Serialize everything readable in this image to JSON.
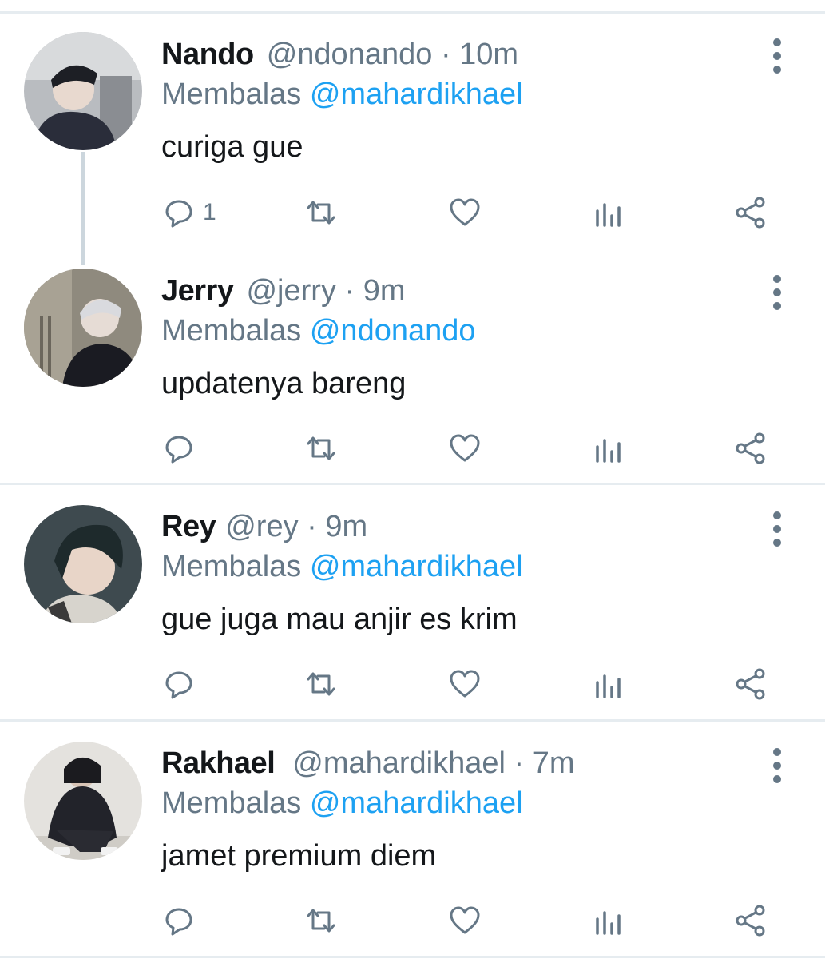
{
  "tweets": [
    {
      "name": "Nando",
      "handle": "@ndonando",
      "time": "· 10m",
      "reply_prefix": "Membalas",
      "reply_to": "@mahardikhael",
      "text": "curiga gue",
      "reply_count": "1",
      "avatar": "avatar-photo"
    },
    {
      "name": "Jerry",
      "handle": "@jerry",
      "time": "· 9m",
      "reply_prefix": "Membalas",
      "reply_to": "@ndonando",
      "text": "updatenya bareng",
      "reply_count": "",
      "avatar": "avatar-photo"
    },
    {
      "name": "Rey",
      "handle": "@rey",
      "time": "· 9m",
      "reply_prefix": "Membalas",
      "reply_to": "@mahardikhael",
      "text": "gue juga mau anjir es krim",
      "reply_count": "",
      "avatar": "avatar-photo"
    },
    {
      "name": "Rakhael",
      "handle": "@mahardikhael",
      "time": "· 7m",
      "reply_prefix": "Membalas",
      "reply_to": "@mahardikhael",
      "text": "jamet premium diem",
      "reply_count": "",
      "avatar": "avatar-photo"
    }
  ],
  "icons": {
    "reply": "reply-icon",
    "retweet": "retweet-icon",
    "like": "heart-icon",
    "analytics": "analytics-icon",
    "share": "share-icon",
    "more": "more-vertical-icon"
  },
  "colors": {
    "name": "#14171a",
    "secondary": "#657786",
    "mention": "#1da1f2",
    "divider": "#e6ecf0",
    "thread_line": "#ccd6dd"
  }
}
